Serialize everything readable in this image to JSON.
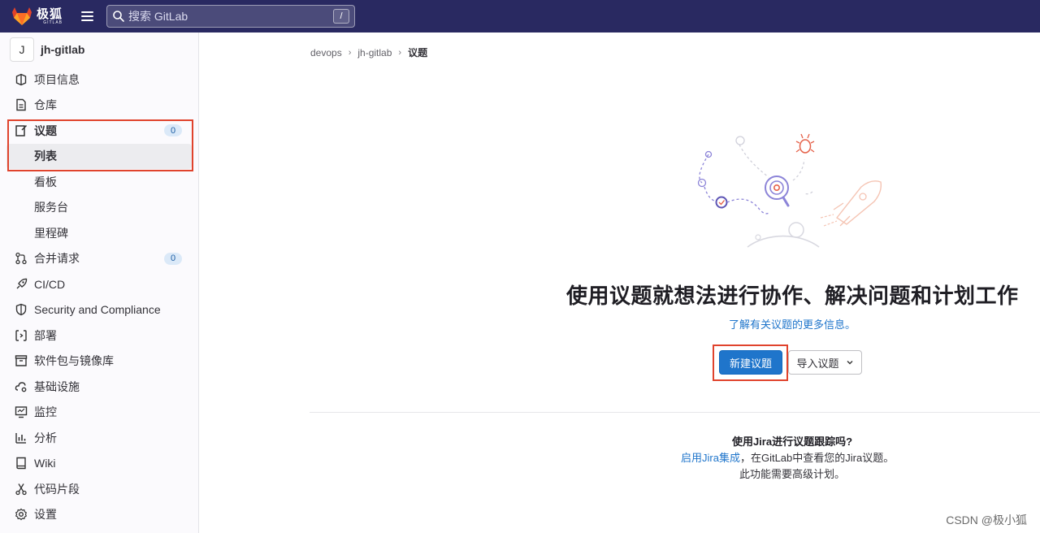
{
  "topbar": {
    "logo_text": "极狐",
    "logo_sub": "GITLAB",
    "search_placeholder": "搜索 GitLab",
    "search_shortcut": "/"
  },
  "sidebar": {
    "project_avatar": "J",
    "project_name": "jh-gitlab",
    "items": [
      {
        "label": "项目信息",
        "icon": "project-info-icon"
      },
      {
        "label": "仓库",
        "icon": "repository-icon"
      },
      {
        "label": "议题",
        "icon": "issues-icon",
        "badge": "0"
      },
      {
        "label": "合并请求",
        "icon": "merge-request-icon",
        "badge": "0"
      },
      {
        "label": "CI/CD",
        "icon": "rocket-icon"
      },
      {
        "label": "Security and Compliance",
        "icon": "shield-icon"
      },
      {
        "label": "部署",
        "icon": "deployments-icon"
      },
      {
        "label": "软件包与镜像库",
        "icon": "package-icon"
      },
      {
        "label": "基础设施",
        "icon": "cloud-gear-icon"
      },
      {
        "label": "监控",
        "icon": "monitor-icon"
      },
      {
        "label": "分析",
        "icon": "chart-icon"
      },
      {
        "label": "Wiki",
        "icon": "book-icon"
      },
      {
        "label": "代码片段",
        "icon": "snippet-icon"
      },
      {
        "label": "设置",
        "icon": "settings-icon"
      }
    ],
    "issues_sub": [
      "列表",
      "看板",
      "服务台",
      "里程碑"
    ]
  },
  "breadcrumb": [
    "devops",
    "jh-gitlab",
    "议题"
  ],
  "empty_state": {
    "title": "使用议题就想法进行协作、解决问题和计划工作",
    "learn_more": "了解有关议题的更多信息。",
    "new_issue": "新建议题",
    "import_issue": "导入议题"
  },
  "jira": {
    "title": "使用Jira进行议题跟踪吗?",
    "link": "启用Jira集成",
    "text": "，在GitLab中查看您的Jira议题。",
    "note": "此功能需要高级计划。"
  },
  "watermark": "CSDN @极小狐",
  "colors": {
    "topbar": "#292961",
    "primary": "#1f75cb",
    "highlight_border": "#e0432d"
  }
}
